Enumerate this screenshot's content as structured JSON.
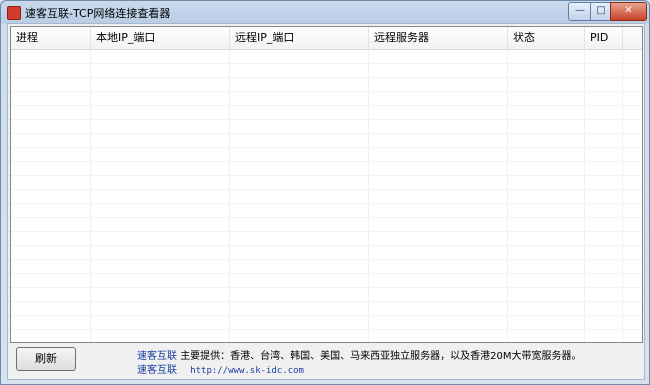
{
  "window": {
    "title": "速客互联-TCP网络连接查看器",
    "controls": {
      "minimize": "—",
      "maximize": "□",
      "close": "✕"
    }
  },
  "table": {
    "columns": [
      "进程",
      "本地IP_端口",
      "远程IP_端口",
      "远程服务器",
      "状态",
      "PID"
    ],
    "rows": []
  },
  "footer": {
    "refresh_label": "刷新",
    "brand": "速客互联",
    "info_text": "主要提供：香港、台湾、韩国、美国、马来西亚独立服务器，以及香港20M大带宽服务器。",
    "link_label": "速客互联",
    "url": "http://www.sk-idc.com"
  },
  "colors": {
    "link": "#1a3fa0",
    "close_button": "#c6442a",
    "titlebar": "#b9cde6"
  }
}
